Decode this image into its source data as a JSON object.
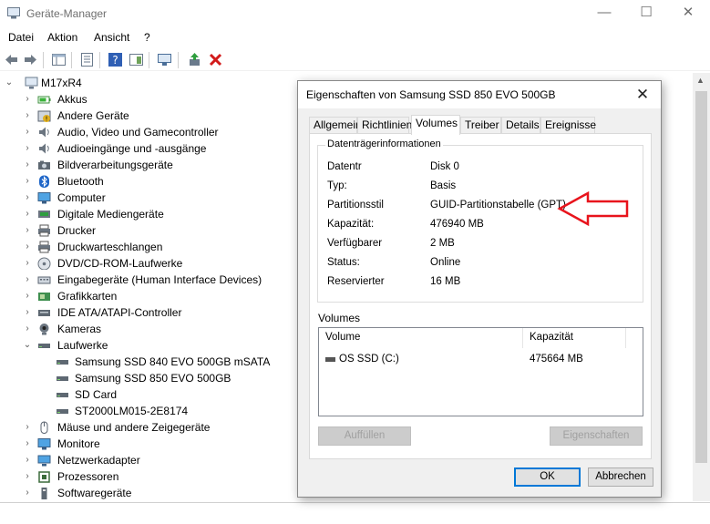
{
  "window": {
    "title": "Geräte-Manager",
    "controls": {
      "minimize": "—",
      "maximize": "☐",
      "close": "✕"
    }
  },
  "menu": [
    "Datei",
    "Aktion",
    "Ansicht",
    "?"
  ],
  "tree": {
    "root": "M17xR4",
    "categories": [
      {
        "label": "Akkus",
        "icon": "battery-icon",
        "expanded": false
      },
      {
        "label": "Andere Geräte",
        "icon": "unknown-device-icon",
        "expanded": false
      },
      {
        "label": "Audio, Video und Gamecontroller",
        "icon": "speaker-icon",
        "expanded": false
      },
      {
        "label": "Audioeingänge und -ausgänge",
        "icon": "speaker-icon",
        "expanded": false
      },
      {
        "label": "Bildverarbeitungsgeräte",
        "icon": "camera-icon",
        "expanded": false
      },
      {
        "label": "Bluetooth",
        "icon": "bluetooth-icon",
        "expanded": false
      },
      {
        "label": "Computer",
        "icon": "monitor-icon",
        "expanded": false
      },
      {
        "label": "Digitale Mediengeräte",
        "icon": "media-device-icon",
        "expanded": false
      },
      {
        "label": "Drucker",
        "icon": "printer-icon",
        "expanded": false
      },
      {
        "label": "Druckwarteschlangen",
        "icon": "printer-icon",
        "expanded": false
      },
      {
        "label": "DVD/CD-ROM-Laufwerke",
        "icon": "disc-icon",
        "expanded": false
      },
      {
        "label": "Eingabegeräte (Human Interface Devices)",
        "icon": "hid-icon",
        "expanded": false
      },
      {
        "label": "Grafikkarten",
        "icon": "display-adapter-icon",
        "expanded": false
      },
      {
        "label": "IDE ATA/ATAPI-Controller",
        "icon": "controller-icon",
        "expanded": false
      },
      {
        "label": "Kameras",
        "icon": "webcam-icon",
        "expanded": false
      },
      {
        "label": "Laufwerke",
        "icon": "drive-icon",
        "expanded": true,
        "children": [
          "Samsung SSD 840 EVO 500GB mSATA",
          "Samsung SSD 850 EVO 500GB",
          "SD Card",
          "ST2000LM015-2E8174"
        ]
      },
      {
        "label": "Mäuse und andere Zeigegeräte",
        "icon": "mouse-icon",
        "expanded": false
      },
      {
        "label": "Monitore",
        "icon": "monitor-icon",
        "expanded": false
      },
      {
        "label": "Netzwerkadapter",
        "icon": "network-icon",
        "expanded": false
      },
      {
        "label": "Prozessoren",
        "icon": "cpu-icon",
        "expanded": false
      },
      {
        "label": "Softwaregeräte",
        "icon": "software-device-icon",
        "expanded": false
      }
    ]
  },
  "dialog": {
    "title": "Eigenschaften von Samsung SSD 850 EVO 500GB",
    "close": "✕",
    "tabs": [
      "Allgemein",
      "Richtlinien",
      "Volumes",
      "Treiber",
      "Details",
      "Ereignisse"
    ],
    "active_tab": "Volumes",
    "group_label": "Datenträgerinformationen",
    "properties": [
      {
        "label": "Datentr",
        "value": "Disk 0"
      },
      {
        "label": "Typ:",
        "value": "Basis"
      },
      {
        "label": "Partitionsstil",
        "value": "GUID-Partitionstabelle (GPT)"
      },
      {
        "label": "Kapazität:",
        "value": "476940 MB"
      },
      {
        "label": "Verfügbarer",
        "value": "2 MB"
      },
      {
        "label": "Status:",
        "value": "Online"
      },
      {
        "label": "Reservierter",
        "value": "16 MB"
      }
    ],
    "volumes_label": "Volumes",
    "volumes_columns": [
      "Volume",
      "Kapazität"
    ],
    "volumes_rows": [
      {
        "volume": "OS SSD (C:)",
        "capacity": "475664 MB"
      }
    ],
    "buttons": {
      "populate": "Auffüllen",
      "properties": "Eigenschaften",
      "ok": "OK",
      "cancel": "Abbrechen"
    }
  },
  "annotation": {
    "arrow_color": "#e8141c"
  }
}
